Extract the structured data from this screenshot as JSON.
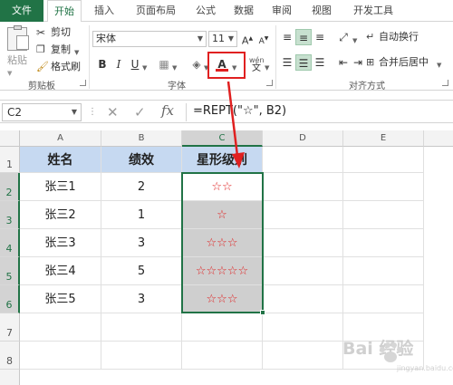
{
  "tabs": [
    {
      "label": "文件"
    },
    {
      "label": "开始"
    },
    {
      "label": "插入"
    },
    {
      "label": "页面布局"
    },
    {
      "label": "公式"
    },
    {
      "label": "数据"
    },
    {
      "label": "审阅"
    },
    {
      "label": "视图"
    },
    {
      "label": "开发工具"
    }
  ],
  "ribbon": {
    "clipboard": {
      "paste": "粘贴",
      "cut": "剪切",
      "copy": "复制",
      "format_painter": "格式刷",
      "group": "剪贴板"
    },
    "font": {
      "name": "宋体",
      "size": "11",
      "group": "字体",
      "wen_label": "wén"
    },
    "alignment": {
      "wrap": "自动换行",
      "merge": "合并后居中",
      "group": "对齐方式"
    }
  },
  "formula_bar": {
    "name_box": "C2",
    "formula": "=REPT(\"☆\", B2)"
  },
  "grid": {
    "columns": [
      "A",
      "B",
      "C",
      "D",
      "E"
    ],
    "rows": [
      "1",
      "2",
      "3",
      "4",
      "5",
      "6",
      "7",
      "8"
    ],
    "headers": {
      "a": "姓名",
      "b": "绩效",
      "c": "星形级别"
    },
    "data": [
      {
        "name": "张三1",
        "score": "2",
        "stars": "☆☆"
      },
      {
        "name": "张三2",
        "score": "1",
        "stars": "☆"
      },
      {
        "name": "张三3",
        "score": "3",
        "stars": "☆☆☆"
      },
      {
        "name": "张三4",
        "score": "5",
        "stars": "☆☆☆☆☆"
      },
      {
        "name": "张三5",
        "score": "3",
        "stars": "☆☆☆"
      }
    ]
  },
  "watermark": {
    "text": "Bai 经验",
    "sub": "jingyan.baidu.com"
  },
  "colors": {
    "accent": "#217346",
    "header_fill": "#c6d9f1",
    "star": "#e02020",
    "highlight": "#e02020"
  }
}
